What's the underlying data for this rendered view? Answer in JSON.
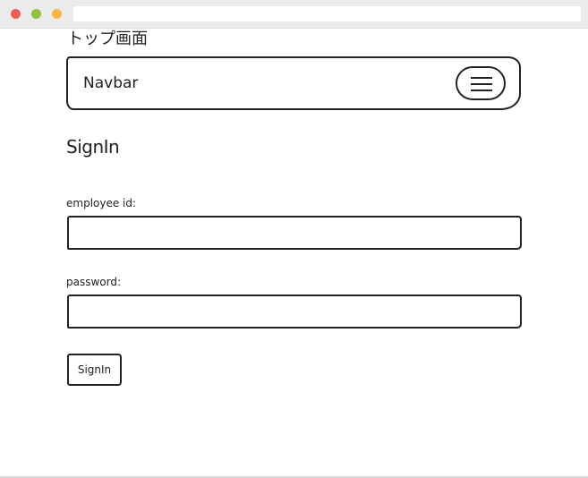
{
  "page": {
    "title": "トップ画面"
  },
  "navbar": {
    "brand": "Navbar",
    "toggle_icon": "hamburger-menu-icon"
  },
  "form": {
    "heading": "SignIn",
    "employee_id_label": "employee id:",
    "employee_id_value": "",
    "password_label": "password:",
    "password_value": "",
    "submit_label": "SignIn"
  },
  "window": {
    "traffic_lights": [
      "#f25b57",
      "#8fc13c",
      "#fcb444"
    ]
  }
}
